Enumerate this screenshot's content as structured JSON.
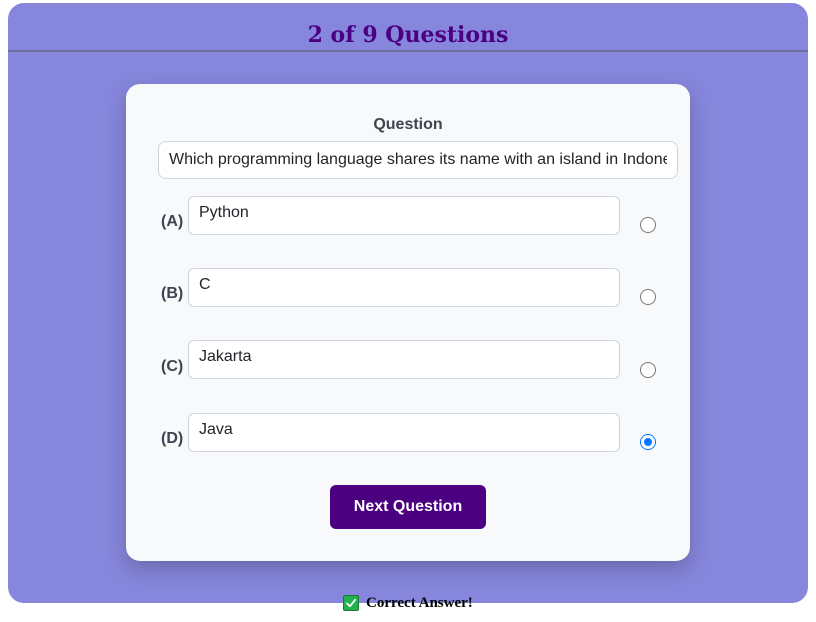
{
  "header": {
    "title": "2 of 9 Questions"
  },
  "question": {
    "label": "Question",
    "value": "Which programming language shares its name with an island in Indonesia?"
  },
  "options": [
    {
      "letter": "(A)",
      "value": "Python",
      "selected": false
    },
    {
      "letter": "(B)",
      "value": "C",
      "selected": false
    },
    {
      "letter": "(C)",
      "value": "Jakarta",
      "selected": false
    },
    {
      "letter": "(D)",
      "value": "Java",
      "selected": true
    }
  ],
  "actions": {
    "next_label": "Next Question"
  },
  "feedback": {
    "icon": "check-mark-icon",
    "text": "Correct Answer!",
    "color": "#22b14c"
  },
  "colors": {
    "background": "#8686dc",
    "accent": "#4b0082",
    "radio_selected": "#0075ff"
  }
}
